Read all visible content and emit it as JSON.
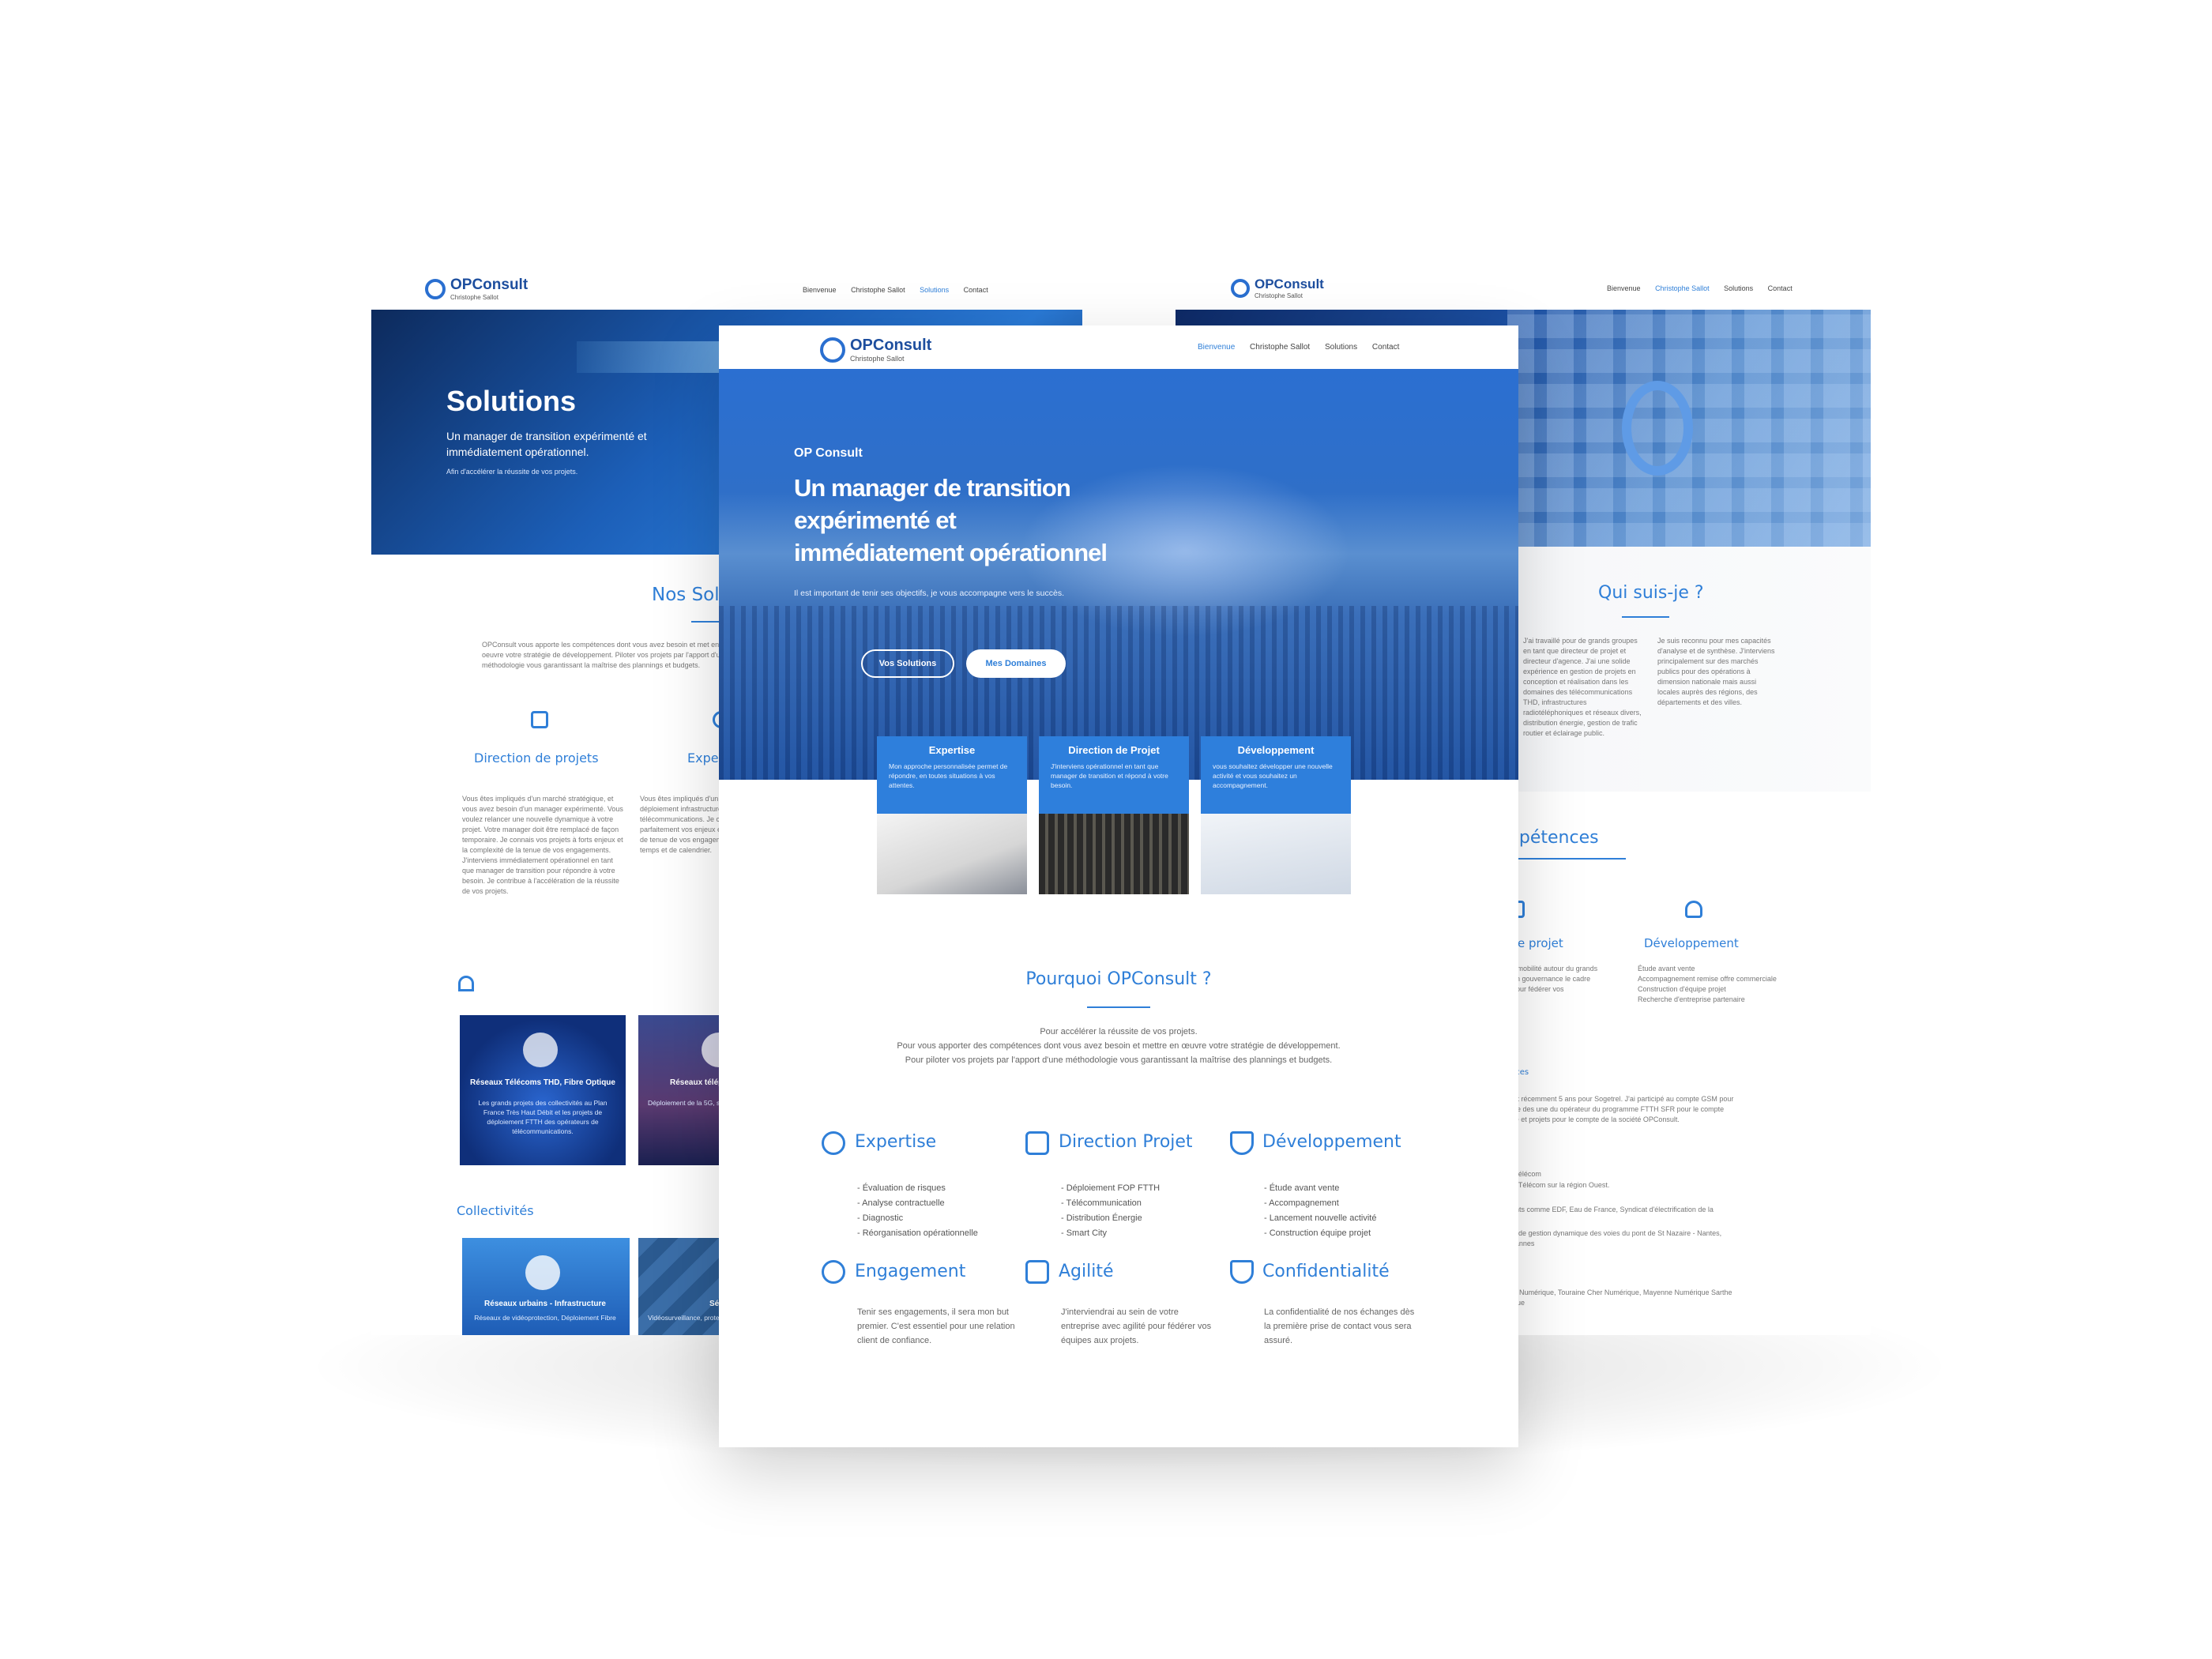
{
  "brand": {
    "name": "OPConsult",
    "tagline": "Christophe Sallot"
  },
  "colors": {
    "accent": "#2f7fd8",
    "dark_blue": "#1d4e9e",
    "hero": "#1a56b0"
  },
  "left_page": {
    "nav": [
      "Bienvenue",
      "Christophe Sallot",
      "Solutions",
      "Contact"
    ],
    "active_nav": "Solutions",
    "hero_title": "Solutions",
    "hero_subtitle": "Un manager de transition expérimenté et immédiatement opérationnel.",
    "hero_small": "Afin d'accélérer la réussite de vos projets.",
    "section_title": "Nos Solutio",
    "intro": "OPConsult vous apporte les compétences dont vous avez besoin et met en oeuvre votre stratégie de développement. Piloter vos projets par l'apport d'une méthodologie vous garantissant la maîtrise des plannings et budgets.",
    "col_titles": [
      "Direction de projets",
      "Expertise"
    ],
    "col1_text": "Vous êtes impliqués d'un marché stratégique, et vous avez besoin d'un manager expérimenté. Vous voulez relancer une nouvelle dynamique à votre projet. Votre manager doit être remplacé de façon temporaire. Je connais vos projets à forts enjeux et la complexité de la tenue de vos engagements. J'interviens immédiatement opérationnel en tant que manager de transition pour répondre à votre besoin. Je contribue à l'accélération de la réussite de vos projets.",
    "col2_text": "Vous êtes impliqués d'un déploiement infrastructure télécommunications. Je connais parfaitement vos enjeux en termes de tenue de vos engagements de temps et de calendrier.",
    "card1_title": "Réseaux Télécoms THD, Fibre Optique",
    "card1_text": "Les grands projets des collectivités au Plan France Très Haut Débit et les projets de déploiement FTTH des opérateurs de télécommunications.",
    "card2_title": "Réseaux téléphonie",
    "card2_text": "Déploiement de la 5G, sites et fibres.",
    "collectivites": "Collectivités",
    "card3_title": "Réseaux urbains - Infrastructure",
    "card3_text": "Réseaux de vidéoprotection, Déploiement Fibre",
    "card4_title": "Sé...",
    "card4_text": "Vidéosurveillance, protection"
  },
  "right_page": {
    "nav": [
      "Bienvenue",
      "Christophe Sallot",
      "Solutions",
      "Contact"
    ],
    "active_nav": "Christophe Sallot",
    "section_title": "Qui suis-je ?",
    "col1_text": "J'ai travaillé pour de grands groupes en tant que directeur de projet et directeur d'agence. J'ai une solide expérience en gestion de projets en conception et réalisation dans les domaines des télécommunications THD, infrastructures radiotéléphoniques et réseaux divers, distribution énergie, gestion de trafic routier et éclairage public.",
    "col2_text": "Je suis reconnu pour mes capacités d'analyse et de synthèse. J'interviens principalement sur des marchés publics pour des opérations à dimension nationale mais aussi locales auprès des régions, des départements et des villes.",
    "competences": "ompétences",
    "comp_titles": [
      "on de projet",
      "Développement"
    ],
    "comp_dev_list": [
      "Étude avant vente",
      "Accompagnement remise offre commerciale",
      "Construction d'équipe projet",
      "Recherche d'entreprise partenaire"
    ],
    "comp_proj_text": "engage mobilité autour du grands sujets en gouvernance le cadre agilité pour fédérer vos",
    "references": "éférences",
    "ref_text_1": "25 ans et récemment 5 ans pour Sogetrel. J'ai participé au compte GSM pour le compte des une du opérateur du programme FTTH SFR pour le compte d'Orange et projets pour le compte de la société OPConsult.",
    "ref_text_2": "France Télécom",
    "ref_text_3": "Sogetrel Télécom sur la région Ouest.",
    "ref_text_4": "Des clients comme EDF, Eau de France, Syndicat d'électrification de la",
    "ref_text_5": "système de gestion dynamique des voies du pont de St Nazaire - Nantes, Laval, Vannes",
    "ref_text_6": "Touraine Numérique, Touraine Cher Numérique, Mayenne Numérique Sarthe Numérique"
  },
  "center_page": {
    "nav": [
      "Bienvenue",
      "Christophe Sallot",
      "Solutions",
      "Contact"
    ],
    "active_nav": "Bienvenue",
    "hero_kicker": "OP Consult",
    "hero_title_l1": "Un manager de transition",
    "hero_title_l2": "expérimenté et",
    "hero_title_l3": "immédiatement opérationnel",
    "hero_text": "Il est important de tenir ses objectifs, je vous accompagne vers le succès.",
    "btn_solutions": "Vos Solutions",
    "btn_domaines": "Mes Domaines",
    "cards": [
      {
        "title": "Expertise",
        "text": "Mon approche personnalisée permet de répondre, en toutes situations à vos attentes."
      },
      {
        "title": "Direction de Projet",
        "text": "J'interviens opérationnel en tant que manager de transition et répond à votre besoin."
      },
      {
        "title": "Développement",
        "text": "vous souhaitez développer une nouvelle activité et vous souhaitez un accompagnement."
      }
    ],
    "why_title": "Pourquoi OPConsult ?",
    "why_lines": [
      "Pour accélérer la réussite de vos projets.",
      "Pour vous apporter des compétences dont vous avez besoin et mettre en œuvre votre stratégie de développement.",
      "Pour piloter vos projets par l'apport d'une méthodologie vous garantissant la maîtrise des plannings et budgets."
    ],
    "features": [
      {
        "title": "Expertise",
        "icon": "target-icon",
        "items": [
          "- Évaluation de risques",
          "- Analyse contractuelle",
          "- Diagnostic",
          "- Réorganisation opérationnelle"
        ]
      },
      {
        "title": "Direction Projet",
        "icon": "chart-board-icon",
        "items": [
          "- Déploiement FOP FTTH",
          "- Télécommunication",
          "- Distribution Énergie",
          "- Smart City"
        ]
      },
      {
        "title": "Développement",
        "icon": "presenter-icon",
        "items": [
          "- Étude avant vente",
          "- Accompagnement",
          "- Lancement nouvelle activité",
          "- Construction équipe projet"
        ]
      },
      {
        "title": "Engagement",
        "icon": "target-icon",
        "text": "Tenir ses engagements, il sera mon but premier. C'est essentiel pour une relation client de confiance."
      },
      {
        "title": "Agilité",
        "icon": "chart-board-icon",
        "text": "J'interviendrai au sein de votre entreprise avec agilité pour fédérer vos équipes aux projets."
      },
      {
        "title": "Confidentialité",
        "icon": "presenter-icon",
        "text": "La confidentialité de nos échanges dès la première prise de contact vous sera assuré."
      }
    ]
  }
}
